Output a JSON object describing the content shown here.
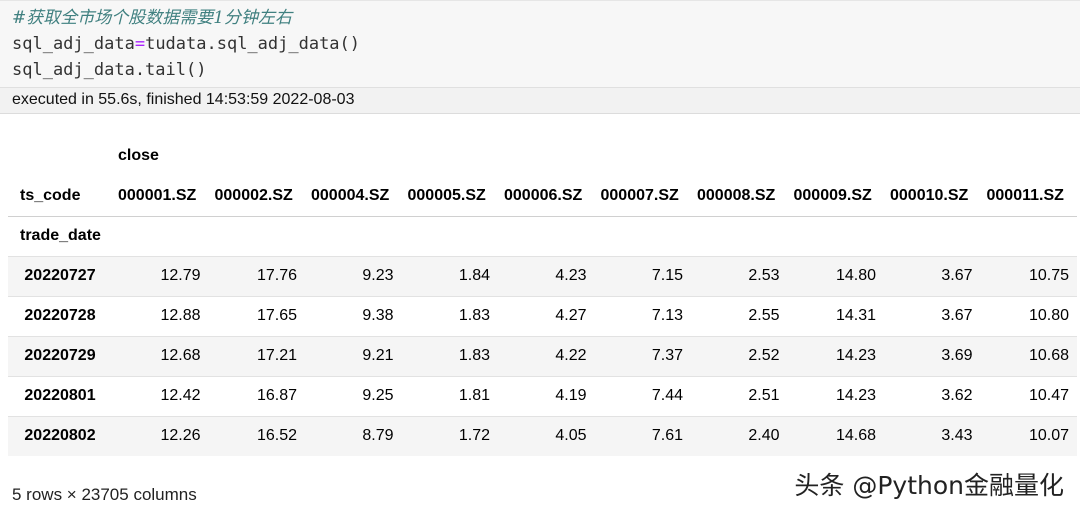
{
  "code": {
    "comment": "#获取全市场个股数据需要1分钟左右",
    "line2_lhs": "sql_adj_data",
    "line2_op": "=",
    "line2_rhs": "tudata.sql_adj_data()",
    "line3": "sql_adj_data.tail()"
  },
  "execution": {
    "text": "executed in 55.6s, finished 14:53:59 2022-08-03"
  },
  "dataframe": {
    "level0_header": "close",
    "level1_name": "ts_code",
    "index_name": "trade_date",
    "columns": [
      "000001.SZ",
      "000002.SZ",
      "000004.SZ",
      "000005.SZ",
      "000006.SZ",
      "000007.SZ",
      "000008.SZ",
      "000009.SZ",
      "000010.SZ",
      "000011.SZ"
    ],
    "rows": [
      {
        "index": "20220727",
        "values": [
          "12.79",
          "17.76",
          "9.23",
          "1.84",
          "4.23",
          "7.15",
          "2.53",
          "14.80",
          "3.67",
          "10.75"
        ]
      },
      {
        "index": "20220728",
        "values": [
          "12.88",
          "17.65",
          "9.38",
          "1.83",
          "4.27",
          "7.13",
          "2.55",
          "14.31",
          "3.67",
          "10.80"
        ]
      },
      {
        "index": "20220729",
        "values": [
          "12.68",
          "17.21",
          "9.21",
          "1.83",
          "4.22",
          "7.37",
          "2.52",
          "14.23",
          "3.69",
          "10.68"
        ]
      },
      {
        "index": "20220801",
        "values": [
          "12.42",
          "16.87",
          "9.25",
          "1.81",
          "4.19",
          "7.44",
          "2.51",
          "14.23",
          "3.62",
          "10.47"
        ]
      },
      {
        "index": "20220802",
        "values": [
          "12.26",
          "16.52",
          "8.79",
          "1.72",
          "4.05",
          "7.61",
          "2.40",
          "14.68",
          "3.43",
          "10.07"
        ]
      }
    ],
    "summary": "5 rows × 23705 columns"
  },
  "watermark": "头条 @Python金融量化"
}
